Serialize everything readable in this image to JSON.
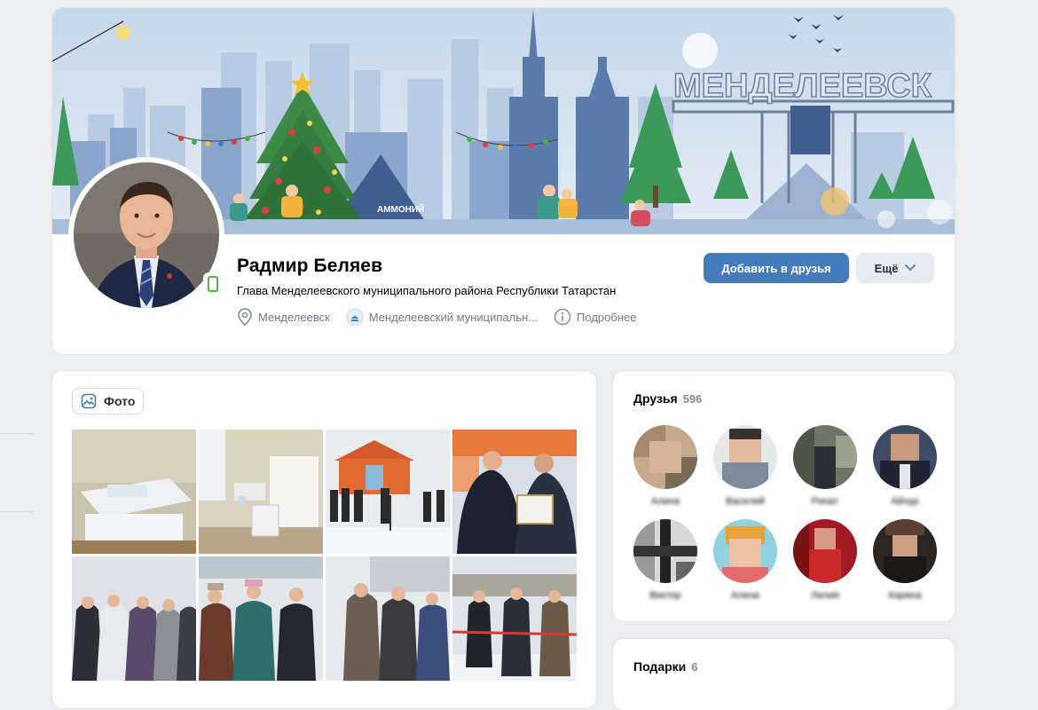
{
  "profile": {
    "name": "Радмир Беляев",
    "status": "Глава Менделеевского муниципального района Республики Татарстан",
    "city": "Менделеевск",
    "workplace": "Менделеевский муниципальн...",
    "more_info": "Подробнее",
    "add_friend_label": "Добавить в друзья",
    "more_label": "Ещё",
    "online_icon": "mobile-online-icon"
  },
  "cover": {
    "town_sign": "МЕНДЕЛЕЕВСК",
    "company_logo": "АММОНИЙ"
  },
  "photos": {
    "tab_label": "Фото"
  },
  "friends": {
    "title": "Друзья",
    "count": "596",
    "items": [
      {
        "name": "Алина"
      },
      {
        "name": "Василий"
      },
      {
        "name": "Ринат"
      },
      {
        "name": "Айнур"
      },
      {
        "name": "Виктор"
      },
      {
        "name": "Алена"
      },
      {
        "name": "Лилия"
      },
      {
        "name": "Карина"
      }
    ]
  },
  "gifts": {
    "title": "Подарки",
    "count": "6"
  },
  "colors": {
    "accent": "#447bba",
    "page_bg": "#edeef0",
    "online": "#4bb34b"
  }
}
